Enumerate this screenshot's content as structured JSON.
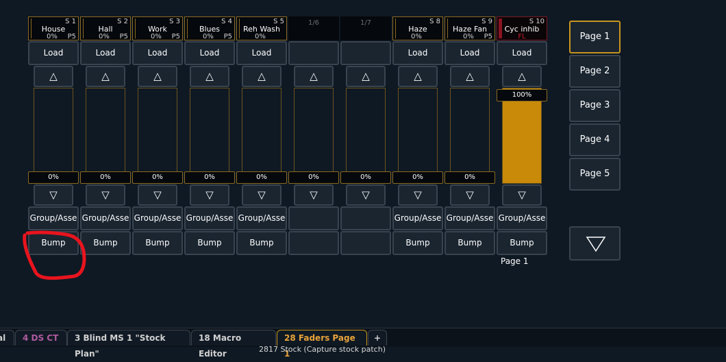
{
  "faders": [
    {
      "slot": "S 1",
      "label": "House",
      "level": "0%",
      "priority": "P5",
      "load": "Load",
      "fader_level": "0%",
      "fill": 0,
      "group": "Group/Asse",
      "bump": "Bump"
    },
    {
      "slot": "S 2",
      "label": "Hall",
      "level": "0%",
      "priority": "P5",
      "load": "Load",
      "fader_level": "0%",
      "fill": 0,
      "group": "Group/Asse",
      "bump": "Bump"
    },
    {
      "slot": "S 3",
      "label": "Work",
      "level": "0%",
      "priority": "P5",
      "load": "Load",
      "fader_level": "0%",
      "fill": 0,
      "group": "Group/Asse",
      "bump": "Bump"
    },
    {
      "slot": "S 4",
      "label": "Blues",
      "level": "0%",
      "priority": "P5",
      "load": "Load",
      "fader_level": "0%",
      "fill": 0,
      "group": "Group/Asse",
      "bump": "Bump"
    },
    {
      "slot": "S 5",
      "label": "Reh Wash",
      "level": "0%",
      "priority": "",
      "load": "Load",
      "fader_level": "0%",
      "fill": 0,
      "group": "Group/Asse",
      "bump": "Bump"
    },
    {
      "page_pos": "1/6",
      "load": "",
      "fader_level": "0%",
      "fill": 0,
      "group": "",
      "bump": ""
    },
    {
      "page_pos": "1/7",
      "load": "",
      "fader_level": "0%",
      "fill": 0,
      "group": "",
      "bump": ""
    },
    {
      "slot": "S 8",
      "label": "Haze",
      "level": "0%",
      "priority": "",
      "load": "Load",
      "fader_level": "0%",
      "fill": 0,
      "group": "Group/Asse",
      "bump": "Bump"
    },
    {
      "slot": "S 9",
      "label": "Haze Fan",
      "level": "0%",
      "priority": "P5",
      "load": "Load",
      "fader_level": "0%",
      "fill": 0,
      "group": "Group/Asse",
      "bump": "Bump"
    },
    {
      "slot": "S 10",
      "label": "Cyc inhib",
      "flag": "FL",
      "load": "Load",
      "fader_level": "100%",
      "fill": 1.0,
      "group": "Group/Asse",
      "bump": "Bump",
      "page_label": "Page 1"
    }
  ],
  "up_arrow": "△",
  "down_arrow": "▽",
  "pages": [
    "Page 1",
    "Page 2",
    "Page 3",
    "Page 4",
    "Page 5"
  ],
  "selected_page": "Page 1",
  "tabs": [
    {
      "label": "al",
      "style": "normal"
    },
    {
      "label": "4 DS  CT",
      "style": "magenta"
    },
    {
      "label": "3 Blind MS 1 \"Stock Plan\"",
      "style": "normal"
    },
    {
      "label": "18 Macro Editor",
      "style": "normal"
    },
    {
      "label": "28 Faders Page 1",
      "style": "active"
    },
    {
      "label": "+",
      "style": "normal"
    }
  ],
  "bottom_text": "2817 Stock (Capture stock patch)",
  "colors": {
    "accent": "#c8961e",
    "fader_fill": "#c88a08",
    "annotation": "#e8141e",
    "inhibit": "#c81e2e"
  }
}
